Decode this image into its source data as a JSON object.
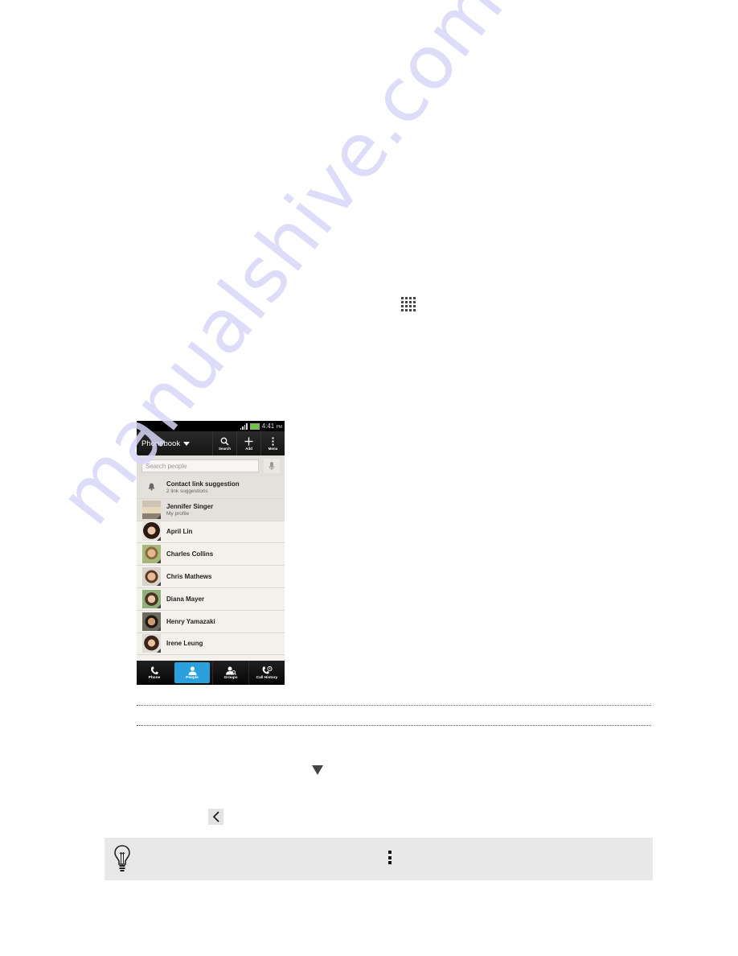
{
  "document": {
    "inline_icons": {
      "all_apps": "all-apps-grid-icon",
      "dropdown": "dropdown-triangle-icon",
      "back": "back-chevron-icon",
      "tip": "lightbulb-icon",
      "menu": "overflow-menu-icon"
    },
    "watermark": "manualshive.com"
  },
  "phone": {
    "status_bar": {
      "time": "4:41",
      "ampm": "PM"
    },
    "action_bar": {
      "title": "Phonebook",
      "buttons": [
        {
          "label": "Search",
          "icon": "search-icon"
        },
        {
          "label": "Add",
          "icon": "plus-icon"
        },
        {
          "label": "Menu",
          "icon": "overflow-menu-icon"
        }
      ]
    },
    "search": {
      "placeholder": "Search people"
    },
    "suggestion": {
      "title": "Contact link suggestion",
      "subtitle": "2 link suggestions"
    },
    "profile": {
      "name": "Jennifer Singer",
      "subtitle": "My profile"
    },
    "contacts": [
      {
        "name": "April Lin"
      },
      {
        "name": "Charles Collins"
      },
      {
        "name": "Chris Mathews"
      },
      {
        "name": "Diana Mayer"
      },
      {
        "name": "Henry Yamazaki"
      },
      {
        "name": "Irene Leung"
      }
    ],
    "tabs": [
      {
        "label": "Phone",
        "active": false
      },
      {
        "label": "People",
        "active": true
      },
      {
        "label": "Groups",
        "active": false
      },
      {
        "label": "Call History",
        "active": false
      }
    ],
    "colors": {
      "accent": "#2aa0dd",
      "battery": "#6dc43a"
    }
  }
}
